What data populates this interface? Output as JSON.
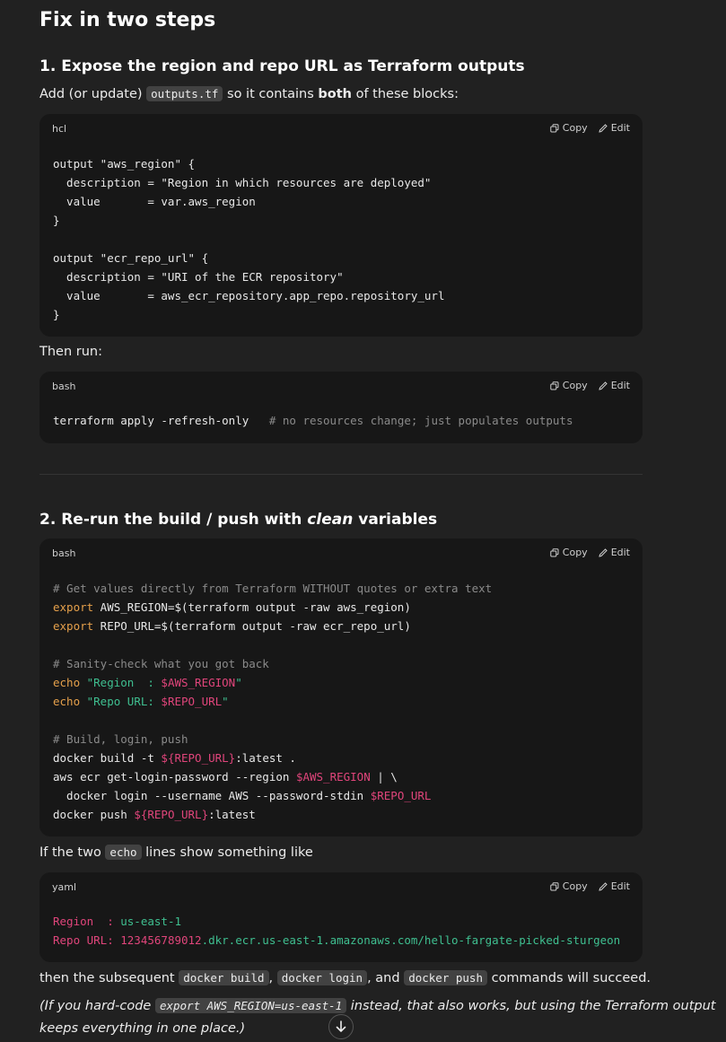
{
  "title": "Fix in two steps",
  "step1": {
    "heading": "1. Expose the region and repo URL as Terraform outputs",
    "intro_pre": "Add (or update) ",
    "intro_code": "outputs.tf",
    "intro_mid": " so it contains ",
    "intro_bold": "both",
    "intro_post": " of these blocks:",
    "then_run": "Then run:"
  },
  "code_buttons": {
    "copy": "Copy",
    "edit": "Edit"
  },
  "blocks": {
    "hcl": {
      "lang": "hcl",
      "lines": [
        "output \"aws_region\" {",
        "  description = \"Region in which resources are deployed\"",
        "  value       = var.aws_region",
        "}",
        "",
        "output \"ecr_repo_url\" {",
        "  description = \"URI of the ECR repository\"",
        "  value       = aws_ecr_repository.app_repo.repository_url",
        "}"
      ]
    },
    "bash1": {
      "lang": "bash",
      "command": "terraform apply -refresh-only",
      "comment": "   # no resources change; just populates outputs"
    },
    "bash2": {
      "lang": "bash",
      "comment1": "# Get values directly from Terraform WITHOUT quotes or extra text",
      "export_kw": "export",
      "line_export1": " AWS_REGION=$(terraform output -raw aws_region)",
      "line_export2": " REPO_URL=$(terraform output -raw ecr_repo_url)",
      "comment2": "# Sanity-check what you got back",
      "echo_kw": "echo",
      "echo1_str": " \"Region  : ",
      "echo1_var": "$AWS_REGION",
      "echo1_end": "\"",
      "echo2_str": " \"Repo URL: ",
      "echo2_var": "$REPO_URL",
      "echo2_end": "\"",
      "comment3": "# Build, login, push",
      "build_pre": "docker build -t ",
      "build_var": "${REPO_URL}",
      "build_post": ":latest .",
      "login1_pre": "aws ecr get-login-password --region ",
      "login1_var": "$AWS_REGION",
      "login1_post": " | \\",
      "login2_pre": "  docker login --username AWS --password-stdin ",
      "login2_var": "$REPO_URL",
      "push_pre": "docker push ",
      "push_var": "${REPO_URL}",
      "push_post": ":latest"
    },
    "yaml": {
      "lang": "yaml",
      "l1_key": "Region  :",
      "l1_val": " us-east-1",
      "l2_key": "Repo URL:",
      "l2_num": " 123456789012",
      "l2_val": ".dkr.ecr.us-east-1.amazonaws.com/hello-fargate-picked-sturgeon"
    }
  },
  "step2": {
    "heading_pre": "2. Re-run the build / push with ",
    "heading_em": "clean",
    "heading_post": " variables",
    "if_pre": "If the two ",
    "if_code": "echo",
    "if_post": " lines show something like",
    "then_pre": "then the subsequent ",
    "then_code1": "docker build",
    "then_sep1": ", ",
    "then_code2": "docker login",
    "then_sep2": ", and ",
    "then_code3": "docker push",
    "then_post": " commands will succeed.",
    "note_pre": "(If you hard-code ",
    "note_code": "export AWS_REGION=us-east-1",
    "note_post1": " instead, that also works, but using the Terraform output",
    "note_post2": "keeps everything in one place.)"
  },
  "colors": {
    "keyword": "#e5a04b",
    "string": "#3fbf90",
    "variable": "#e0457b",
    "comment": "#8a8a8a"
  }
}
